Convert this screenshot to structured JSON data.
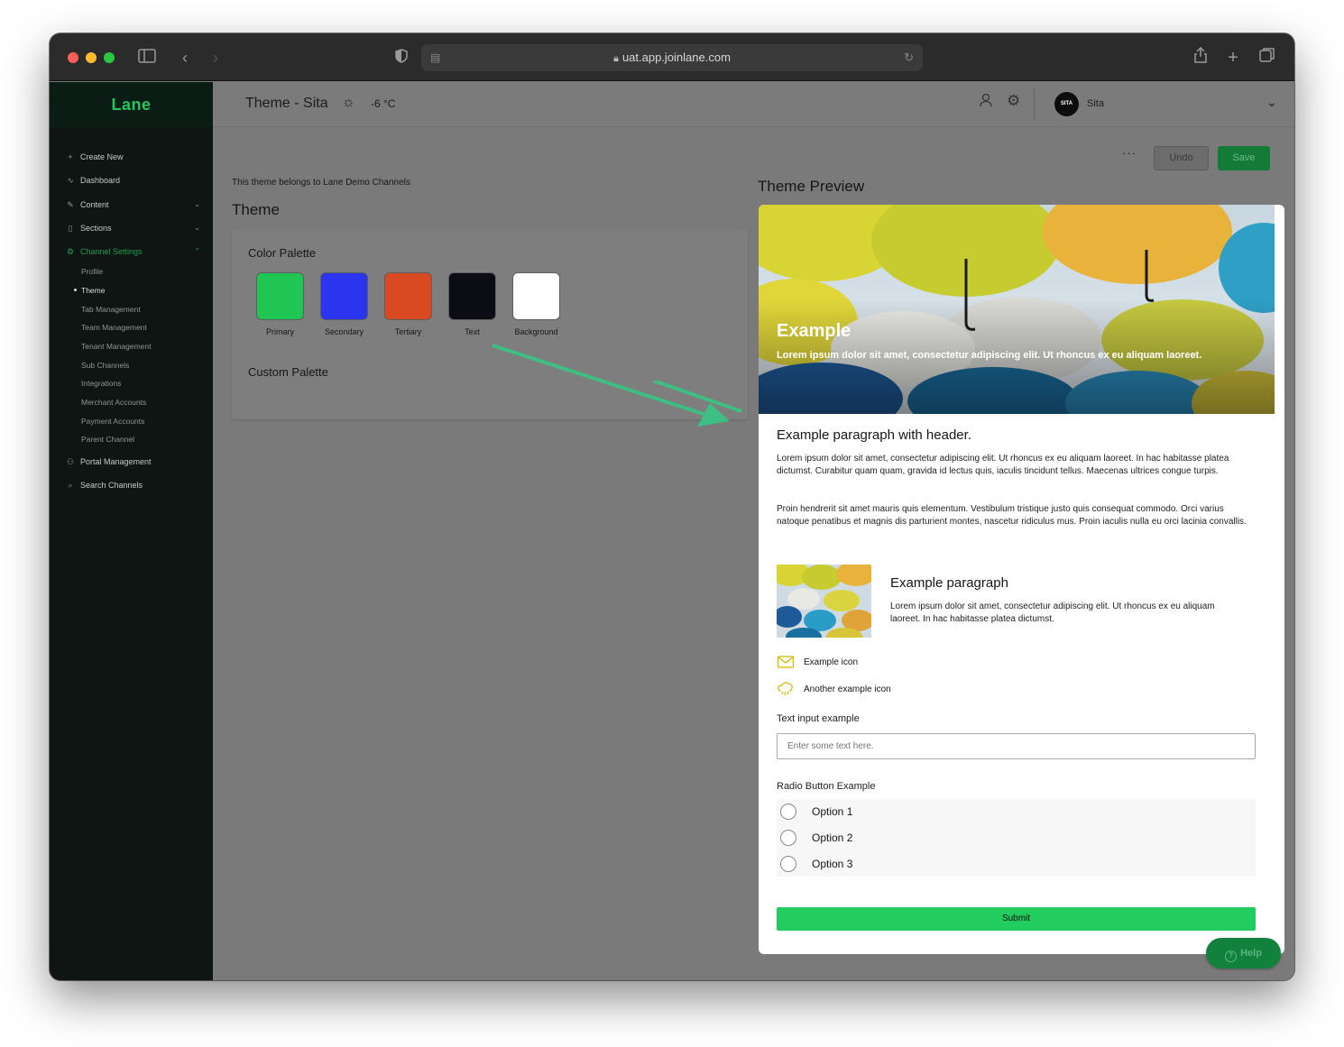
{
  "browser": {
    "url": "uat.app.joinlane.com"
  },
  "sidebar": {
    "logo": "Lane",
    "items": [
      {
        "label": "Create New",
        "icon": "plus-icon"
      },
      {
        "label": "Dashboard",
        "icon": "activity-icon"
      },
      {
        "label": "Content",
        "icon": "edit-icon"
      },
      {
        "label": "Sections",
        "icon": "book-icon"
      },
      {
        "label": "Channel Settings",
        "icon": "settings-icon"
      },
      {
        "label": "Portal Management",
        "icon": "users-icon"
      },
      {
        "label": "Search Channels",
        "icon": "search-icon"
      }
    ],
    "sub_items": [
      {
        "label": "Profile"
      },
      {
        "label": "Theme"
      },
      {
        "label": "Tab Management"
      },
      {
        "label": "Team Management"
      },
      {
        "label": "Tenant Management"
      },
      {
        "label": "Sub Channels"
      },
      {
        "label": "Integrations"
      },
      {
        "label": "Merchant Accounts"
      },
      {
        "label": "Payment Accounts"
      },
      {
        "label": "Parent Channel"
      }
    ]
  },
  "topbar": {
    "title": "Theme - Sita",
    "temperature": "-6 °C",
    "avatar_text": "SITA",
    "user_name": "Sita"
  },
  "toolbar": {
    "more": "···",
    "undo": "Undo",
    "save": "Save"
  },
  "editor": {
    "belongs_text": "This theme belongs to Lane Demo Channels",
    "heading": "Theme",
    "color_palette_title": "Color Palette",
    "custom_palette_title": "Custom Palette",
    "swatches": [
      {
        "label": "Primary",
        "color": "#1fc653"
      },
      {
        "label": "Secondary",
        "color": "#2b34ee"
      },
      {
        "label": "Tertiary",
        "color": "#d94a22"
      },
      {
        "label": "Text",
        "color": "#0b0c14"
      },
      {
        "label": "Background",
        "color": "#ffffff"
      }
    ]
  },
  "preview": {
    "title": "Theme Preview",
    "hero_title": "Example",
    "hero_subtitle": "Lorem ipsum dolor sit amet, consectetur adipiscing elit. Ut rhoncus ex eu aliquam laoreet.",
    "para_header": "Example paragraph with header.",
    "para_1": "Lorem ipsum dolor sit amet, consectetur adipiscing elit. Ut rhoncus ex eu aliquam laoreet. In hac habitasse platea dictumst. Curabitur quam quam, gravida id lectus quis, iaculis tincidunt tellus. Maecenas ultrices congue turpis.",
    "para_2": "Proin hendrerit sit amet mauris quis elementum. Vestibulum tristique justo quis consequat commodo. Orci varius natoque penatibus et magnis dis parturient montes, nascetur ridiculus mus. Proin iaculis nulla eu orci lacinia convallis.",
    "side_header": "Example paragraph",
    "side_text": "Lorem ipsum dolor sit amet, consectetur adipiscing elit. Ut rhoncus ex eu aliquam laoreet. In hac habitasse platea dictumst.",
    "icon_1": "Example icon",
    "icon_2": "Another example icon",
    "input_label": "Text input example",
    "input_placeholder": "Enter some text here.",
    "radio_label": "Radio Button Example",
    "radio_options": [
      "Option 1",
      "Option 2",
      "Option 3"
    ],
    "submit": "Submit"
  },
  "help": {
    "label": "Help"
  },
  "colors": {
    "accent": "#22c55e",
    "icon_yellow": "#d4b800"
  }
}
